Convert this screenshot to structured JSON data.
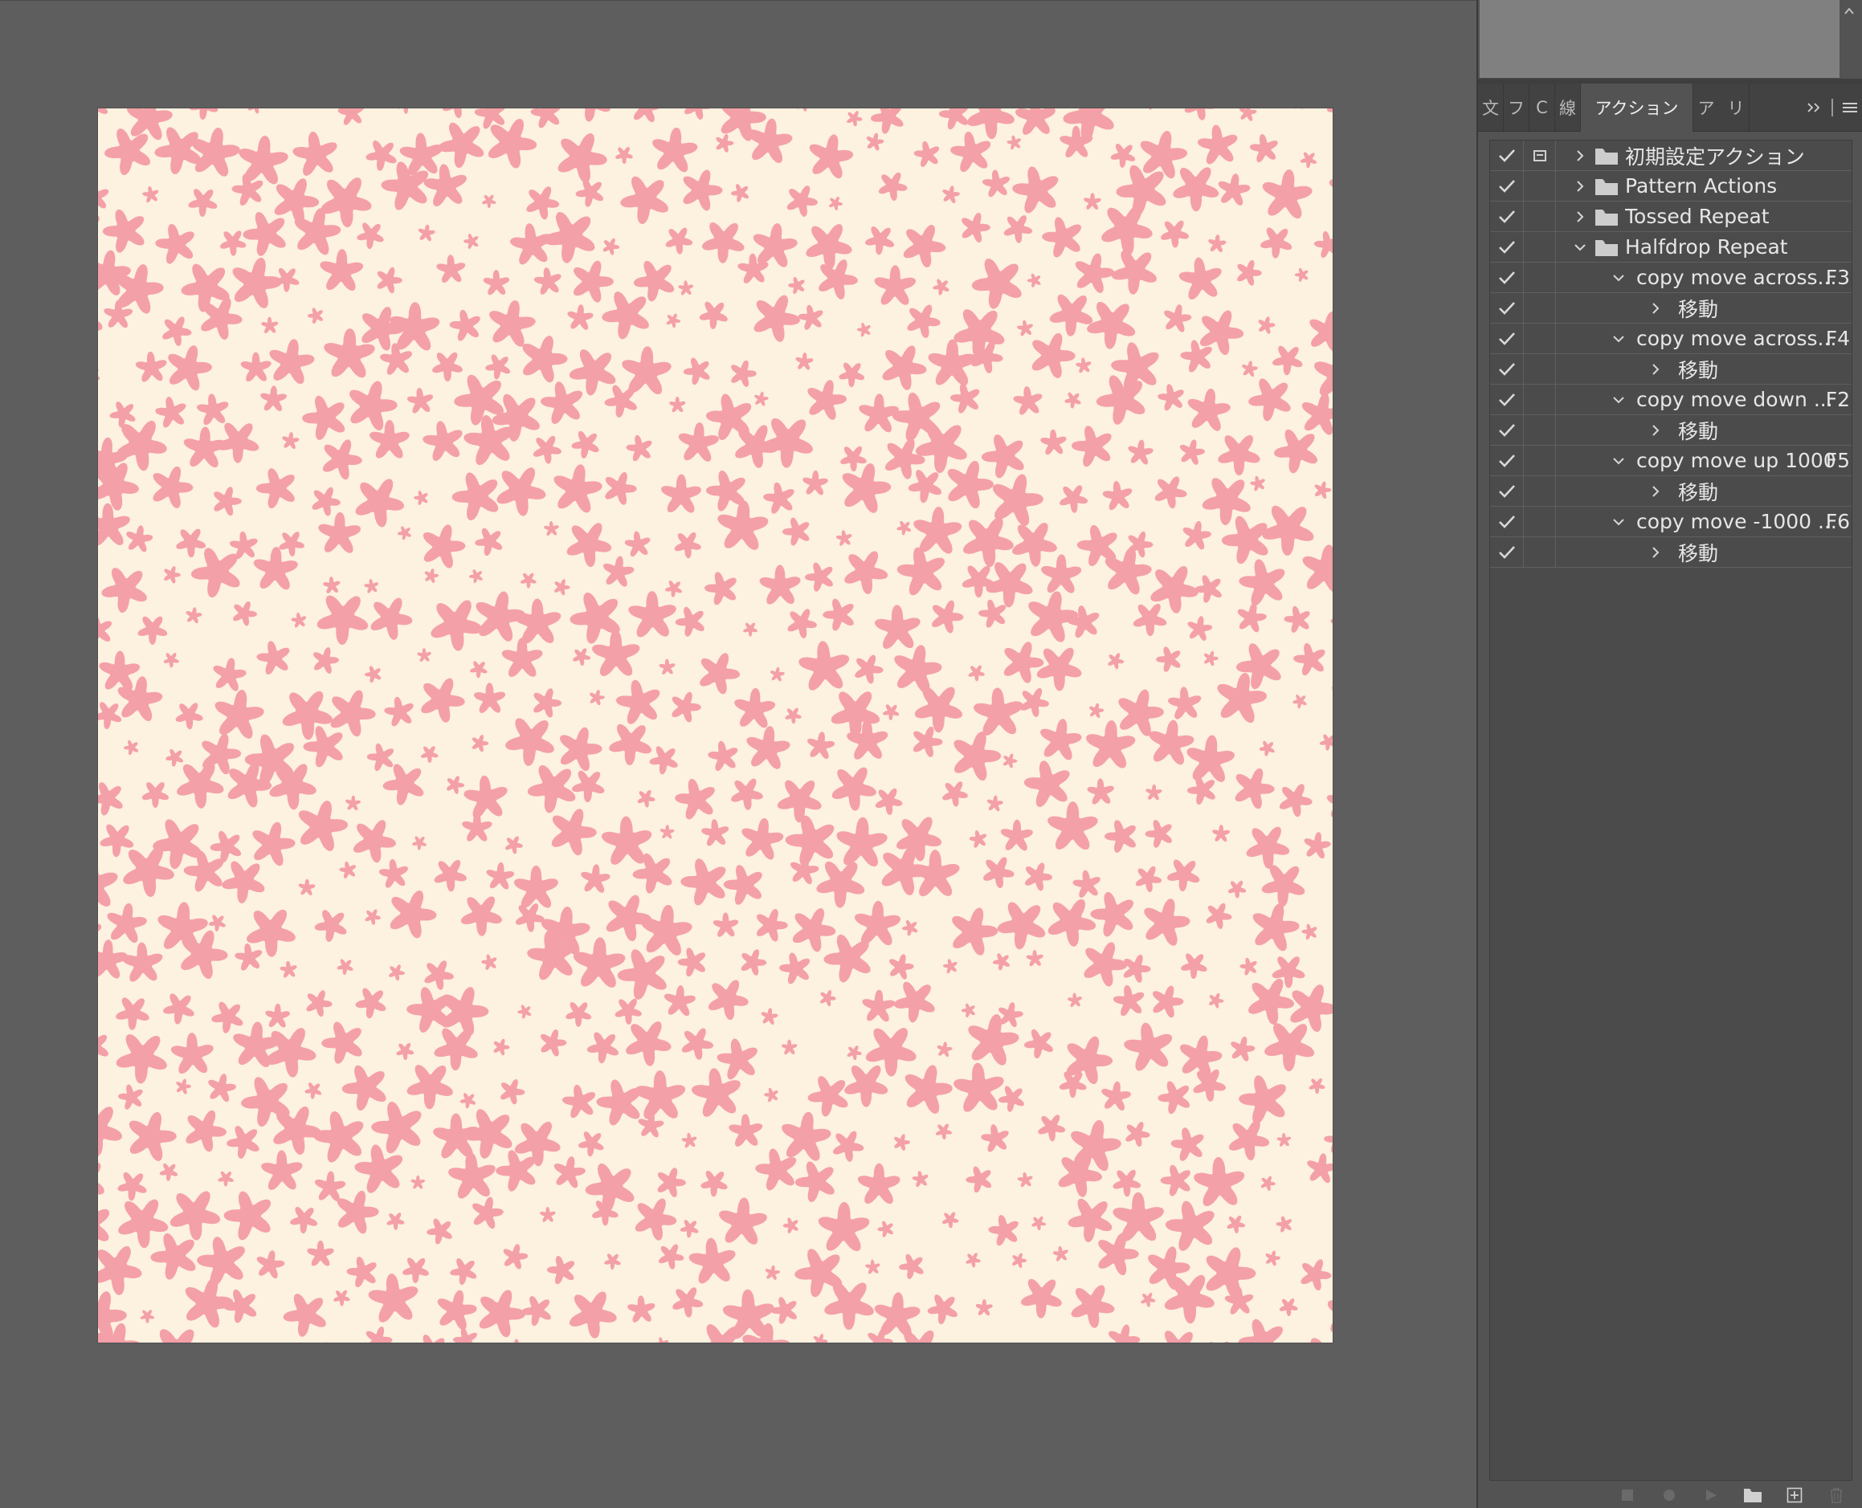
{
  "app": {
    "colors": {
      "workspace": "#5e5e5e",
      "panel": "#535353",
      "artboard_background": "#fdf1e0",
      "flower": "#f4a0a8"
    }
  },
  "dock": {
    "scroll_up_icon": "chevron-up-icon",
    "tabs": [
      {
        "label": "文"
      },
      {
        "label": "フ"
      },
      {
        "label": "C"
      },
      {
        "label": "線"
      },
      {
        "label": "アクション",
        "active": true
      },
      {
        "label": "ア"
      },
      {
        "label": "リ"
      }
    ],
    "overflow_icon": "double-chevron-right-icon",
    "menu_icon": "hamburger-menu-icon"
  },
  "actions": {
    "rows": [
      {
        "checked": true,
        "dialog": true,
        "level": 0,
        "expanded": false,
        "type": "set",
        "label": "初期設定アクション",
        "key": ""
      },
      {
        "checked": true,
        "dialog": false,
        "level": 0,
        "expanded": false,
        "type": "set",
        "label": "Pattern Actions",
        "key": ""
      },
      {
        "checked": true,
        "dialog": false,
        "level": 0,
        "expanded": false,
        "type": "set",
        "label": "Tossed Repeat",
        "key": ""
      },
      {
        "checked": true,
        "dialog": false,
        "level": 0,
        "expanded": true,
        "type": "set",
        "label": "Halfdrop Repeat",
        "key": ""
      },
      {
        "checked": true,
        "dialog": false,
        "level": 1,
        "expanded": true,
        "type": "action",
        "label": "copy move across...",
        "key": "F3"
      },
      {
        "checked": true,
        "dialog": false,
        "level": 2,
        "expanded": false,
        "type": "step",
        "label": "移動",
        "key": ""
      },
      {
        "checked": true,
        "dialog": false,
        "level": 1,
        "expanded": true,
        "type": "action",
        "label": "copy move across...",
        "key": "F4"
      },
      {
        "checked": true,
        "dialog": false,
        "level": 2,
        "expanded": false,
        "type": "step",
        "label": "移動",
        "key": ""
      },
      {
        "checked": true,
        "dialog": false,
        "level": 1,
        "expanded": true,
        "type": "action",
        "label": "copy move down ...",
        "key": "F2"
      },
      {
        "checked": true,
        "dialog": false,
        "level": 2,
        "expanded": false,
        "type": "step",
        "label": "移動",
        "key": ""
      },
      {
        "checked": true,
        "dialog": false,
        "level": 1,
        "expanded": true,
        "type": "action",
        "label": "copy move up 1000",
        "key": "F5"
      },
      {
        "checked": true,
        "dialog": false,
        "level": 2,
        "expanded": false,
        "type": "step",
        "label": "移動",
        "key": ""
      },
      {
        "checked": true,
        "dialog": false,
        "level": 1,
        "expanded": true,
        "type": "action",
        "label": "copy move -1000 ...",
        "key": "F6"
      },
      {
        "checked": true,
        "dialog": false,
        "level": 2,
        "expanded": false,
        "type": "step",
        "label": "移動",
        "key": ""
      }
    ],
    "toolbar": [
      {
        "name": "stop-button",
        "icon": "stop-icon",
        "enabled": false
      },
      {
        "name": "record-button",
        "icon": "record-icon",
        "enabled": false
      },
      {
        "name": "play-button",
        "icon": "play-icon",
        "enabled": false
      },
      {
        "name": "new-set-button",
        "icon": "folder-icon",
        "enabled": true
      },
      {
        "name": "new-action-button",
        "icon": "new-item-icon",
        "enabled": true
      },
      {
        "name": "delete-button",
        "icon": "trash-icon",
        "enabled": false
      }
    ]
  }
}
